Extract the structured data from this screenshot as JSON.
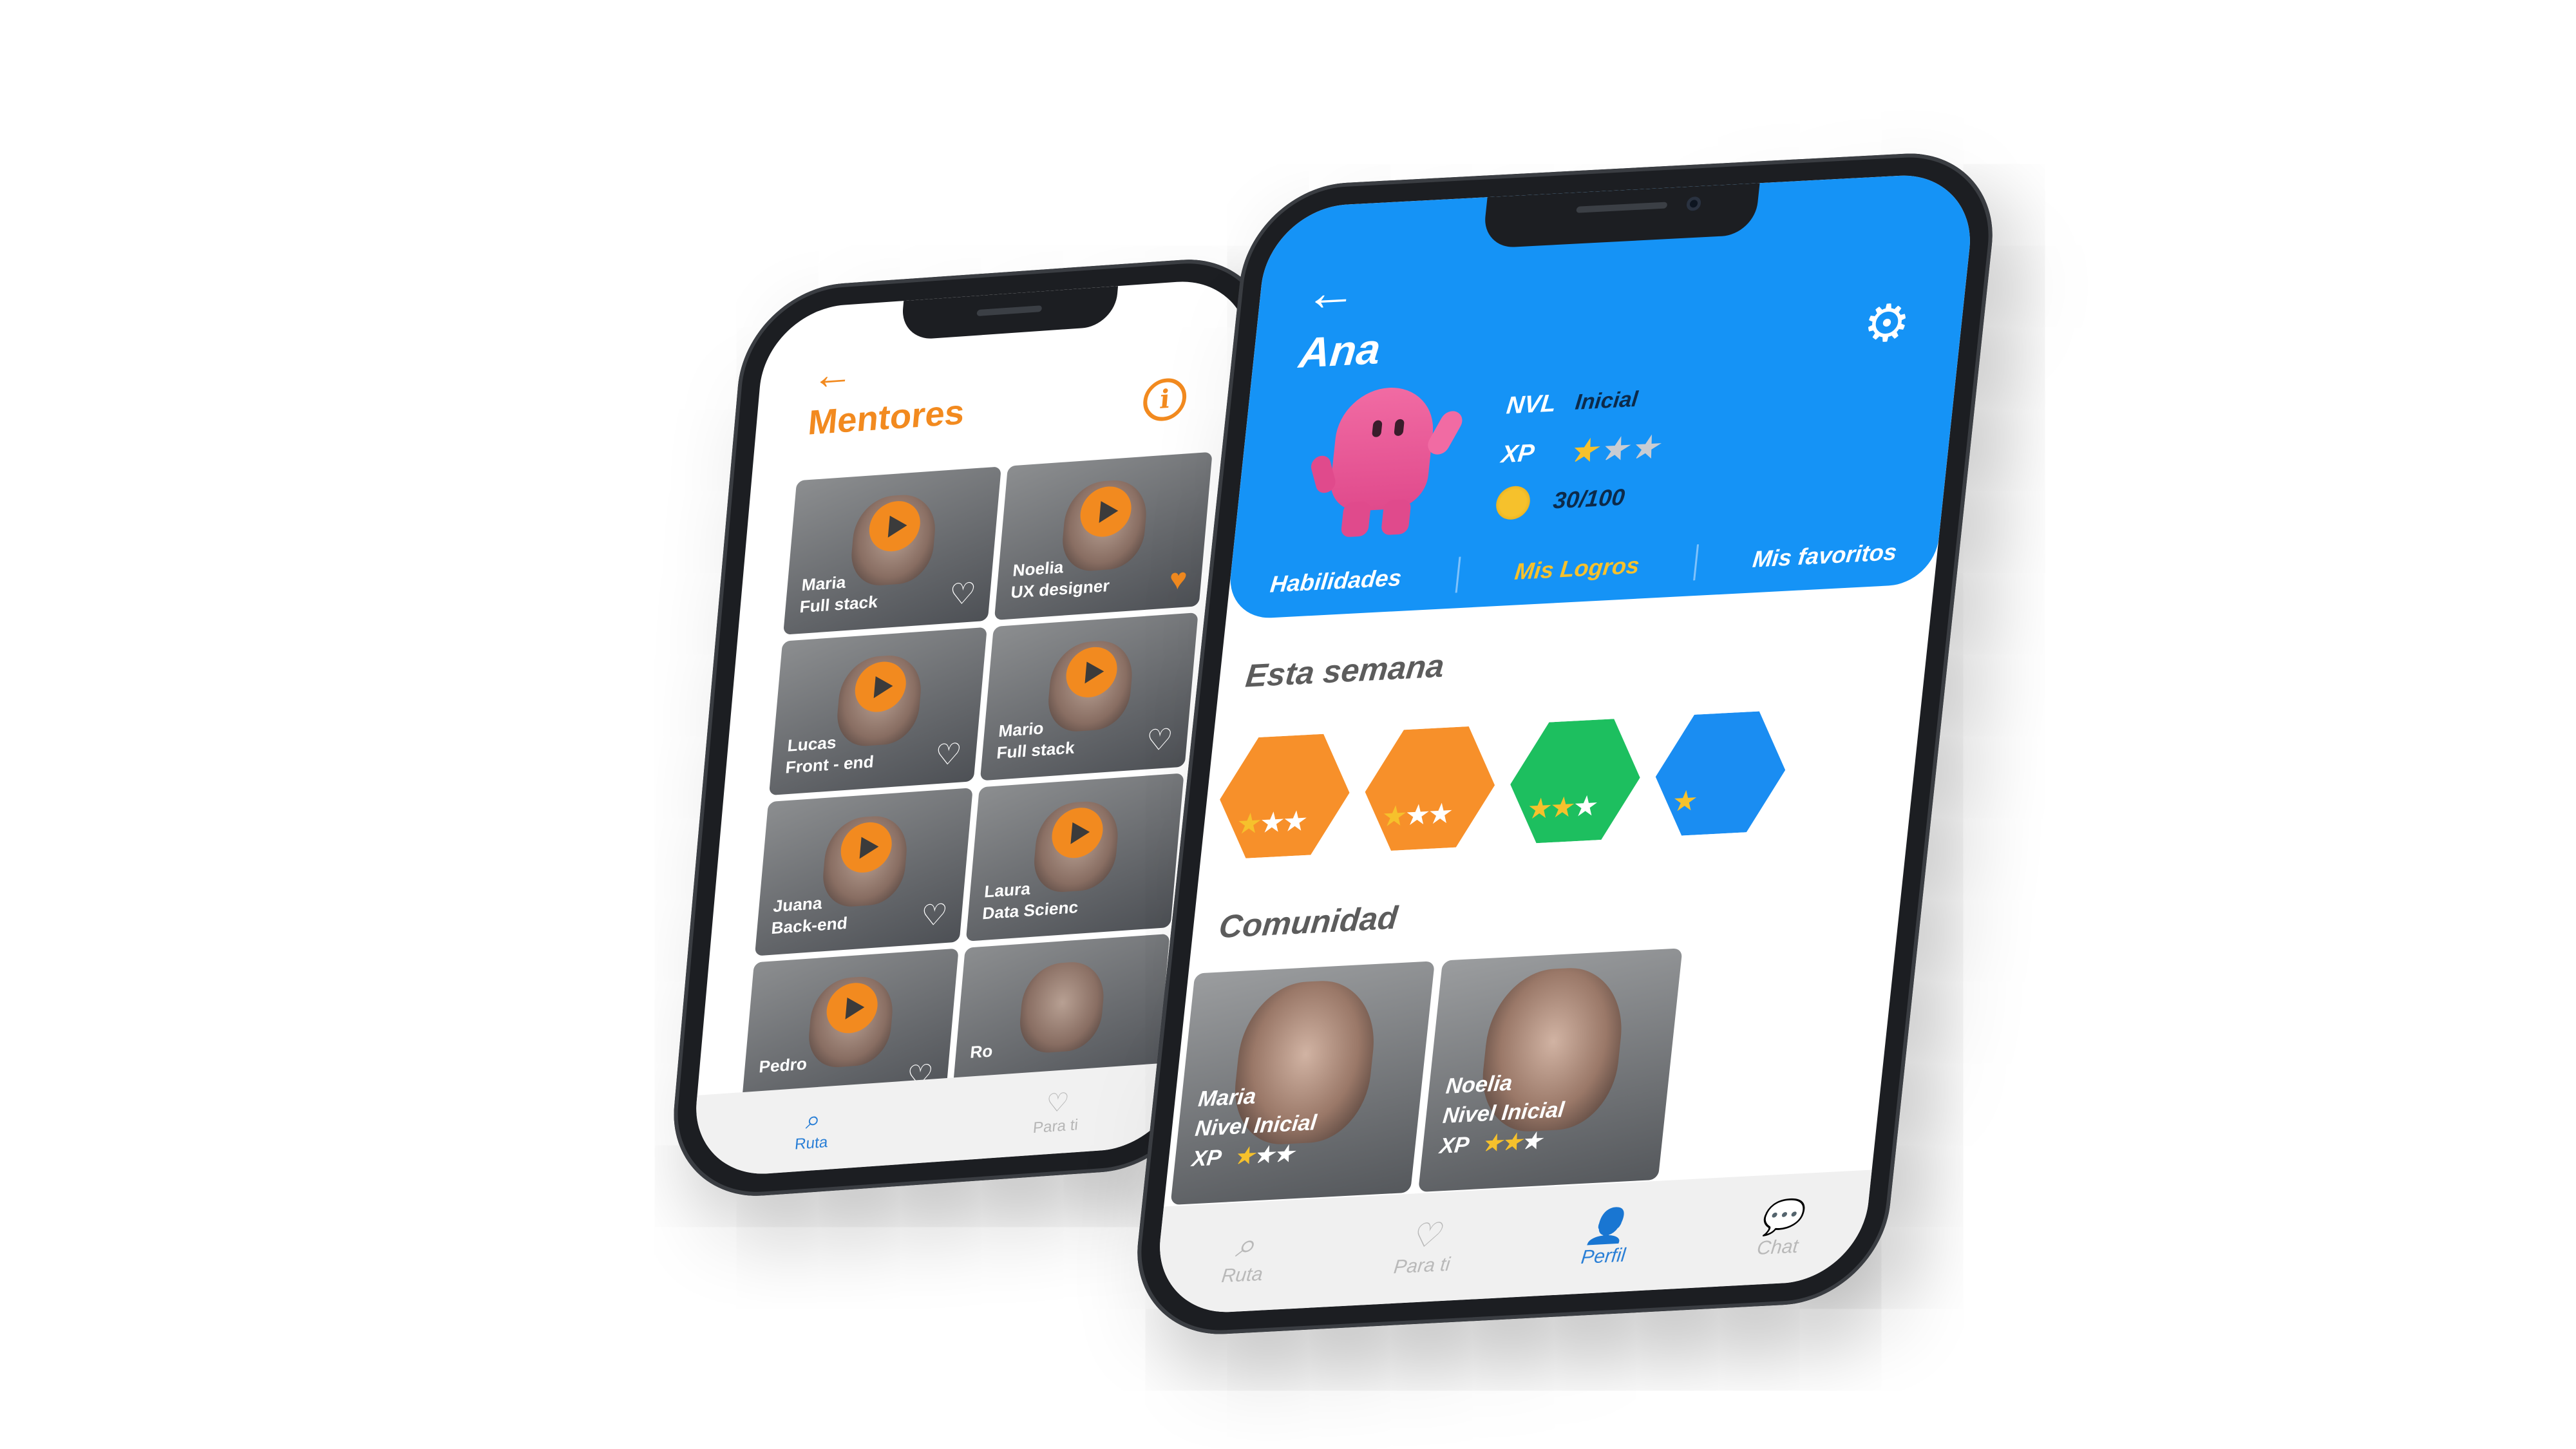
{
  "mentors_screen": {
    "back_icon": "←",
    "title": "Mentores",
    "info_icon": "i",
    "mentors": [
      {
        "name": "Maria",
        "role": "Full stack",
        "favorite": false
      },
      {
        "name": "Noelia",
        "role": "UX designer",
        "favorite": true
      },
      {
        "name": "Lucas",
        "role": "Front - end",
        "favorite": false
      },
      {
        "name": "Mario",
        "role": "Full stack",
        "favorite": false
      },
      {
        "name": "Juana",
        "role": "Back-end",
        "favorite": false
      },
      {
        "name": "Laura",
        "role": "Data Scienc",
        "favorite": false
      },
      {
        "name": "Pedro",
        "role": "",
        "favorite": false
      },
      {
        "name": "Ro",
        "role": "",
        "favorite": false
      }
    ],
    "nav": [
      {
        "label": "Ruta",
        "icon": "search-icon",
        "active": true
      },
      {
        "label": "Para ti",
        "icon": "heart-icon",
        "active": false
      }
    ]
  },
  "profile_screen": {
    "back_icon": "←",
    "user_name": "Ana",
    "settings_icon": "gear-icon",
    "level_key": "NVL",
    "level_value": "Inicial",
    "xp_key": "XP",
    "xp_stars": 1,
    "xp_stars_total": 3,
    "coins": "30/100",
    "tabs": [
      {
        "label": "Habilidades",
        "active": false
      },
      {
        "label": "Mis Logros",
        "active": true
      },
      {
        "label": "Mis favoritos",
        "active": false
      }
    ],
    "week_title": "Esta semana",
    "badges": [
      {
        "color": "#f7902a",
        "stars_on": 1
      },
      {
        "color": "#f7902a",
        "stars_on": 1
      },
      {
        "color": "#1dbf5f",
        "stars_on": 2
      },
      {
        "color": "#1a8df2",
        "stars_on": 1
      }
    ],
    "community_title": "Comunidad",
    "community": [
      {
        "name": "Maria",
        "level": "Nivel Inicial",
        "xp": "XP",
        "stars_on": 1
      },
      {
        "name": "Noelia",
        "level": "Nivel Inicial",
        "xp": "XP",
        "stars_on": 2
      }
    ],
    "nav": [
      {
        "label": "Ruta",
        "icon": "search-icon",
        "active": false
      },
      {
        "label": "Para ti",
        "icon": "heart-icon",
        "active": false
      },
      {
        "label": "Perfil",
        "icon": "user-icon",
        "active": true
      },
      {
        "label": "Chat",
        "icon": "chat-icon",
        "active": false
      }
    ]
  },
  "colors": {
    "orange": "#f28a1f",
    "blue": "#1593f6",
    "gold": "#f6c12c",
    "green": "#1dbf5f"
  }
}
